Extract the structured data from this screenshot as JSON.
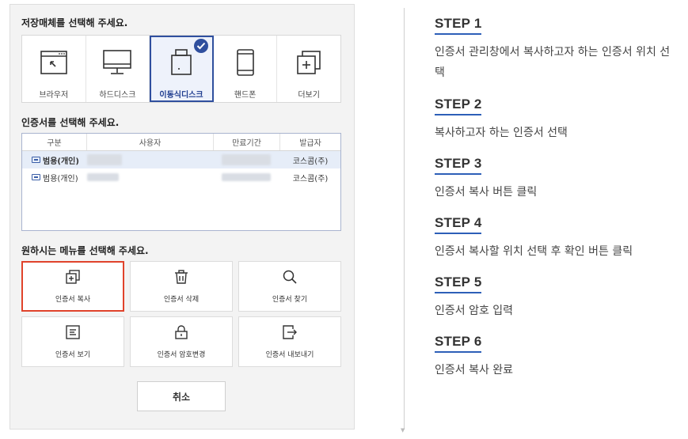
{
  "storage": {
    "title": "저장매체를 선택해 주세요.",
    "items": [
      {
        "label": "브라우저",
        "icon": "browser-icon"
      },
      {
        "label": "하드디스크",
        "icon": "monitor-icon"
      },
      {
        "label": "이동식디스크",
        "icon": "usb-disk-icon",
        "selected": true
      },
      {
        "label": "핸드폰",
        "icon": "phone-icon"
      },
      {
        "label": "더보기",
        "icon": "more-icon"
      }
    ]
  },
  "certs": {
    "title": "인증서를 선택해 주세요.",
    "columns": [
      "구분",
      "사용자",
      "만료기간",
      "발급자"
    ],
    "rows": [
      {
        "type": "범용(개인)",
        "issuer": "코스콤(주)",
        "selected": true
      },
      {
        "type": "범용(개인)",
        "issuer": "코스콤(주)",
        "selected": false
      }
    ]
  },
  "menu": {
    "title": "원하시는 메뉴를 선택해 주세요.",
    "items": [
      {
        "label": "인증서 복사",
        "icon": "copy-icon",
        "active": true
      },
      {
        "label": "인증서 삭제",
        "icon": "trash-icon"
      },
      {
        "label": "인증서 찾기",
        "icon": "search-icon"
      },
      {
        "label": "인증서 보기",
        "icon": "document-icon"
      },
      {
        "label": "인증서 암호변경",
        "icon": "lock-icon"
      },
      {
        "label": "인증서 내보내기",
        "icon": "export-icon"
      }
    ]
  },
  "cancel_label": "취소",
  "steps": [
    {
      "title": "STEP 1",
      "desc": "인증서 관리창에서 복사하고자 하는 인증서 위치 선택"
    },
    {
      "title": "STEP 2",
      "desc": "복사하고자 하는 인증서 선택"
    },
    {
      "title": "STEP 3",
      "desc": "인증서 복사 버튼 클릭"
    },
    {
      "title": "STEP 4",
      "desc": "인증서 복사할 위치 선택 후 확인 버튼 클릭"
    },
    {
      "title": "STEP 5",
      "desc": "인증서 암호 입력"
    },
    {
      "title": "STEP 6",
      "desc": "인증서 복사 완료"
    }
  ],
  "colors": {
    "accent": "#2f4f9e",
    "highlight": "#e0432b",
    "step_underline": "#2d5fb8"
  }
}
